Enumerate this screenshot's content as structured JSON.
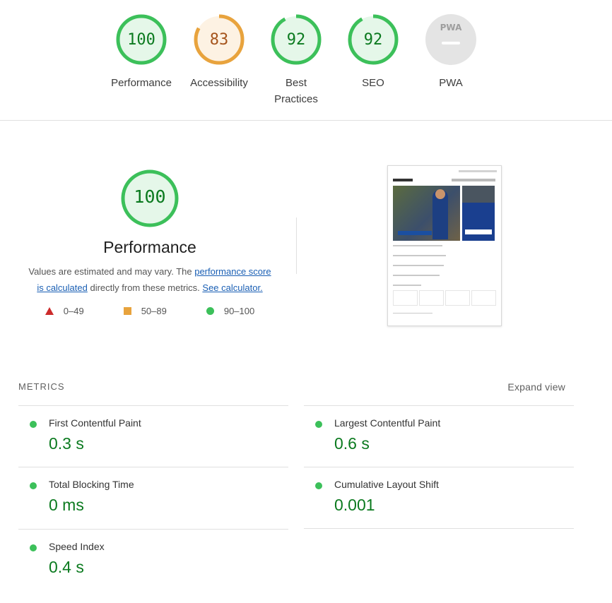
{
  "categories": [
    {
      "label": "Performance",
      "score": "100",
      "value": 100,
      "color": "#0b7a1f",
      "ring": "#3cc05a",
      "bg": "#e5f7e9"
    },
    {
      "label": "Accessibility",
      "score": "83",
      "value": 83,
      "color": "#a5541c",
      "ring": "#e8a33d",
      "bg": "#fdf2e3"
    },
    {
      "label": "Best\nPractices",
      "score": "92",
      "value": 92,
      "color": "#0b7a1f",
      "ring": "#3cc05a",
      "bg": "#e5f7e9"
    },
    {
      "label": "SEO",
      "score": "92",
      "value": 92,
      "color": "#0b7a1f",
      "ring": "#3cc05a",
      "bg": "#e5f7e9"
    },
    {
      "label": "PWA",
      "badge": "PWA",
      "color": "#9e9e9e",
      "bg": "#e4e4e4"
    }
  ],
  "hero": {
    "score": "100",
    "title": "Performance",
    "desc_1": "Values are estimated and may vary. The ",
    "link_1": "performance score",
    "link_2": "is calculated",
    "desc_2": " directly from these metrics. ",
    "link_3": "See calculator."
  },
  "legend": [
    {
      "range": "0–49",
      "icon": "triangle-icon"
    },
    {
      "range": "50–89",
      "icon": "square-icon"
    },
    {
      "range": "90–100",
      "icon": "circle-icon"
    }
  ],
  "metrics": {
    "header": "METRICS",
    "expand_label": "Expand view",
    "items": [
      {
        "name": "First Contentful Paint",
        "value": "0.3 s"
      },
      {
        "name": "Largest Contentful Paint",
        "value": "0.6 s"
      },
      {
        "name": "Total Blocking Time",
        "value": "0 ms"
      },
      {
        "name": "Cumulative Layout Shift",
        "value": "0.001"
      },
      {
        "name": "Speed Index",
        "value": "0.4 s"
      }
    ]
  },
  "colors": {
    "pass": "#3cc05a",
    "average": "#e8a33d",
    "fail": "#cc2b2b",
    "link": "#1a5fb4"
  }
}
